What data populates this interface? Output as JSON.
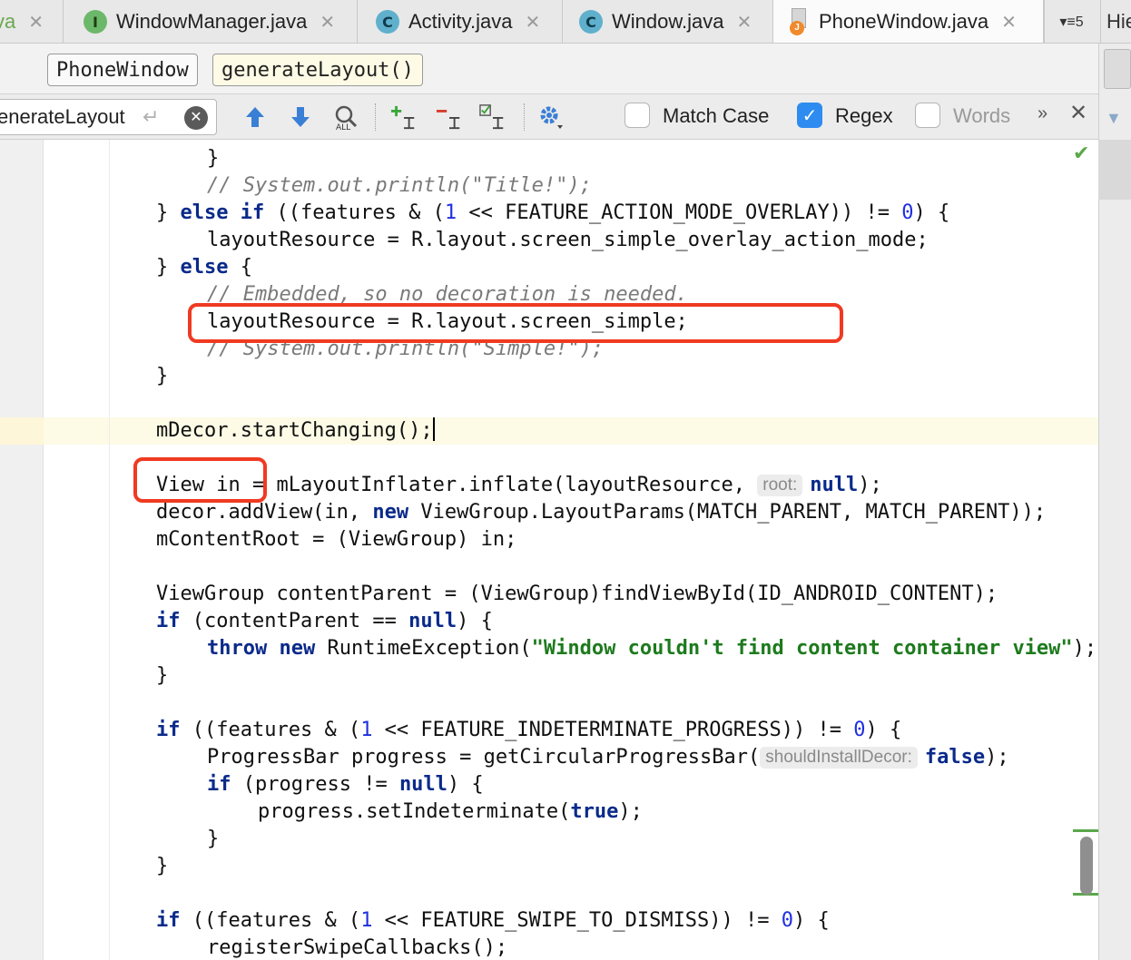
{
  "tabs": [
    {
      "label": "va",
      "icon": "java-file-icon",
      "active": false
    },
    {
      "label": "WindowManager.java",
      "icon_letter": "I",
      "icon": "interface-icon",
      "active": false
    },
    {
      "label": "Activity.java",
      "icon_letter": "C",
      "icon": "class-icon",
      "active": false
    },
    {
      "label": "Window.java",
      "icon_letter": "C",
      "icon": "class-icon",
      "active": false
    },
    {
      "label": "PhoneWindow.java",
      "icon_letter": "J",
      "icon": "java-file-icon",
      "active": true
    }
  ],
  "tab_close": "✕",
  "tab_overflow": {
    "label": "▾≡5",
    "icon": "tab-list-icon"
  },
  "side_panel_label": "Hie",
  "breadcrumb": {
    "class": "PhoneWindow",
    "method": "generateLayout()"
  },
  "find": {
    "value": "enerateLayout",
    "options": {
      "match_case": {
        "label": "Match Case",
        "checked": false
      },
      "regex": {
        "label": "Regex",
        "checked": true
      },
      "words": {
        "label": "Words",
        "checked": false
      }
    },
    "more": "»",
    "close": "✕"
  },
  "code": {
    "hints": {
      "root": "root:",
      "shouldInstallDecor": "shouldInstallDecor:"
    },
    "lines": [
      "}",
      "// System.out.println(\"Title!\");",
      "} else if ((features & (1 << FEATURE_ACTION_MODE_OVERLAY)) != 0) {",
      "layoutResource = R.layout.screen_simple_overlay_action_mode;",
      "} else {",
      "// Embedded, so no decoration is needed.",
      "layoutResource = R.layout.screen_simple;",
      "// System.out.println(\"Simple!\");",
      "}",
      "mDecor.startChanging();",
      "View in = mLayoutInflater.inflate(layoutResource, root: null);",
      "decor.addView(in, new ViewGroup.LayoutParams(MATCH_PARENT, MATCH_PARENT));",
      "mContentRoot = (ViewGroup) in;",
      "ViewGroup contentParent = (ViewGroup)findViewById(ID_ANDROID_CONTENT);",
      "if (contentParent == null) {",
      "throw new RuntimeException(\"Window couldn't find content container view\");",
      "}",
      "if ((features & (1 << FEATURE_INDETERMINATE_PROGRESS)) != 0) {",
      "ProgressBar progress = getCircularProgressBar(shouldInstallDecor: false);",
      "if (progress != null) {",
      "progress.setIndeterminate(true);",
      "}",
      "}",
      "if ((features & (1 << FEATURE_SWIPE_TO_DISMISS)) != 0) {",
      "registerSwipeCallbacks();"
    ]
  },
  "colors": {
    "highlight_box": "#f03a22",
    "keyword": "#0a2a8a",
    "string": "#1d7a1d",
    "number": "#1f2fe0",
    "comment": "#7a7a7a"
  }
}
